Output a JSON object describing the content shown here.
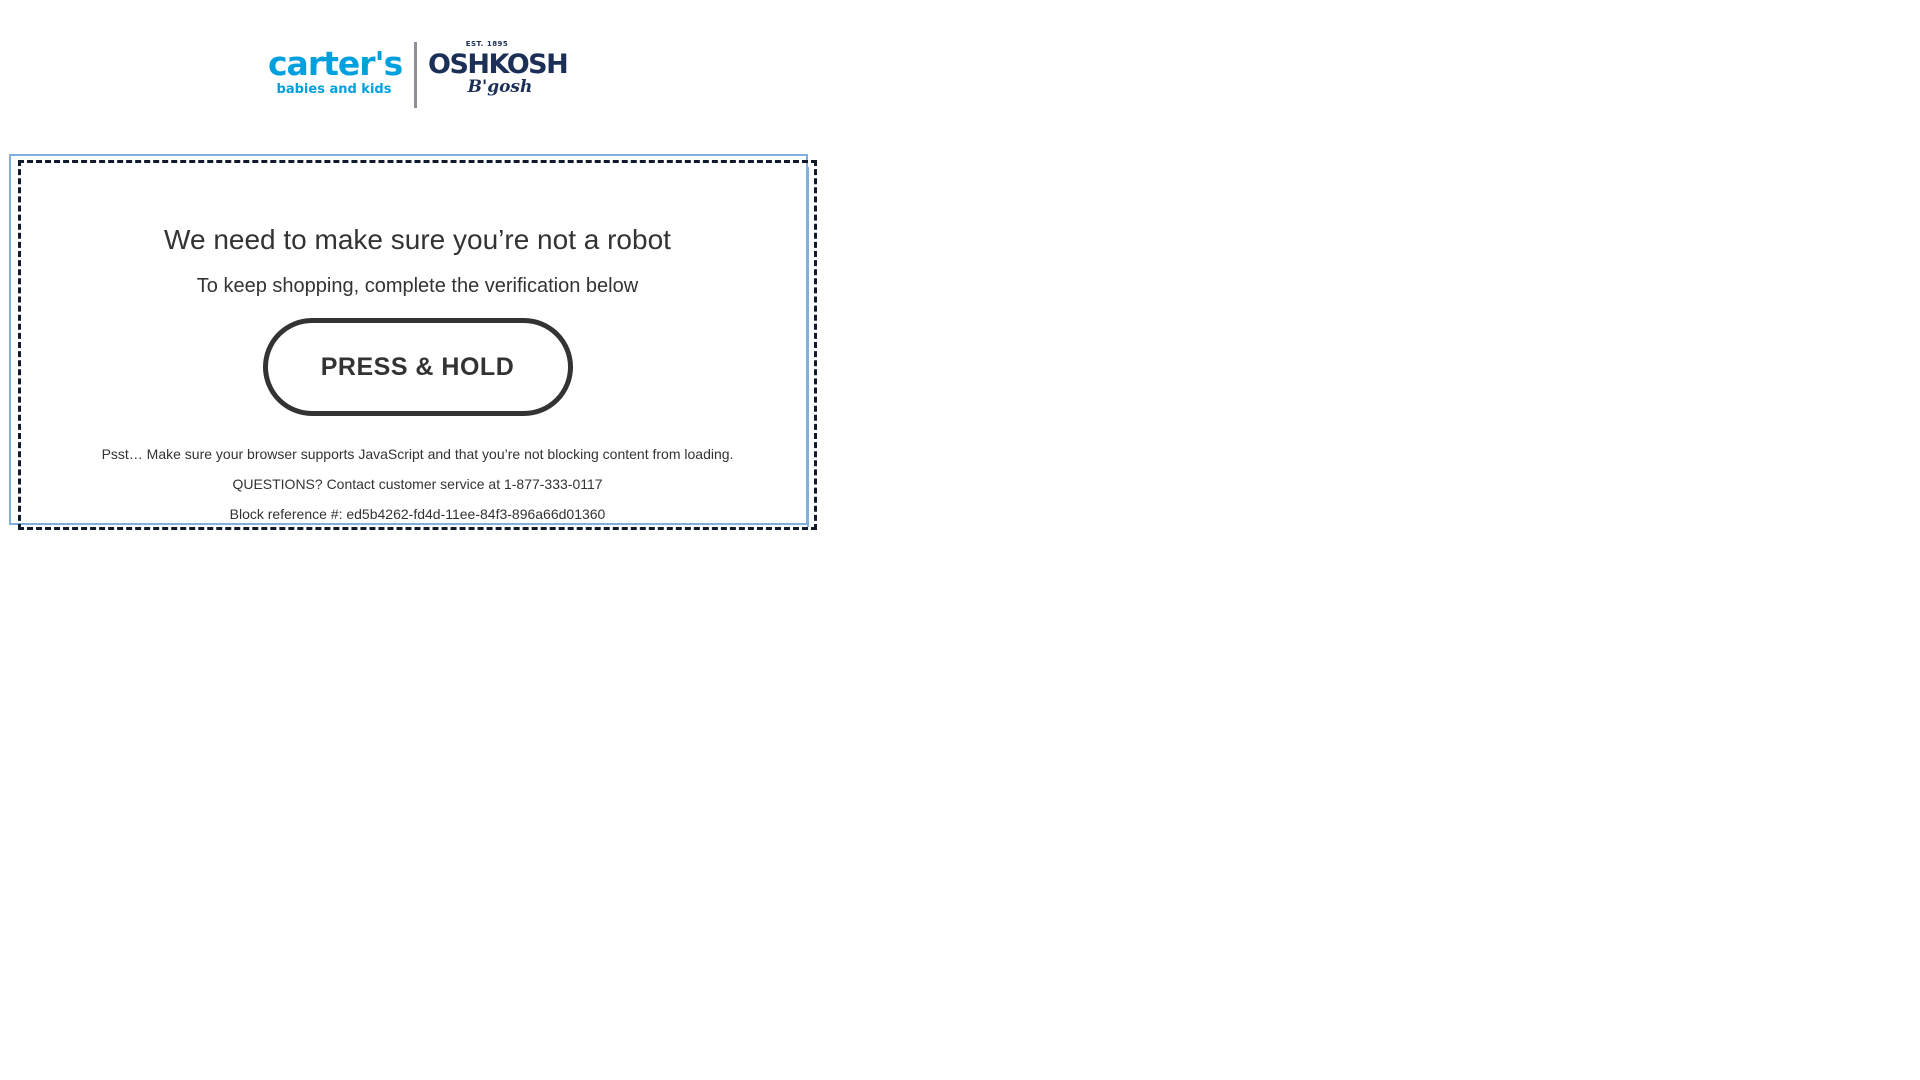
{
  "logos": {
    "carters_wordmark": "carter's",
    "carters_tagline": "babies and kids",
    "oshkosh_established": "EST. 1895",
    "oshkosh_wordmark": "OSHKOSH",
    "oshkosh_script": "B'gosh"
  },
  "challenge": {
    "headline": "We need to make sure you’re not a robot",
    "subhead": "To keep shopping, complete the verification below",
    "button_label": "PRESS & HOLD",
    "notice": "Psst… Make sure your browser supports JavaScript and that you’re not blocking content from loading.",
    "questions": "QUESTIONS? Contact customer service at 1-877-333-0117",
    "block_reference": "Block reference #: ed5b4262-fd4d-11ee-84f3-896a66d01360"
  },
  "colors": {
    "carters_blue": "#00a0df",
    "oshkosh_navy": "#1b2f57",
    "text": "#333333",
    "frame_blue": "#7fb0e0",
    "frame_dash": "#111a2b"
  }
}
